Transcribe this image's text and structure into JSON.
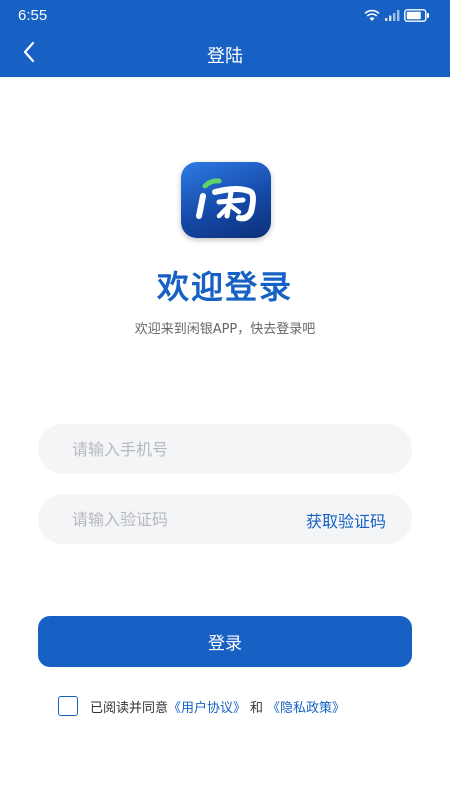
{
  "status_bar": {
    "time": "6:55",
    "icons": [
      "wifi-icon",
      "signal-icon",
      "battery-icon"
    ]
  },
  "nav": {
    "title": "登陆",
    "back_icon": "chevron-left-icon"
  },
  "logo": {
    "icon": "app-logo",
    "glyph_text": "闲"
  },
  "welcome": {
    "title": "欢迎登录",
    "subtitle": "欢迎来到闲银APP，快去登录吧"
  },
  "form": {
    "phone_placeholder": "请输入手机号",
    "phone_value": "",
    "code_placeholder": "请输入验证码",
    "code_value": "",
    "get_code_label": "获取验证码"
  },
  "login_button": "登录",
  "agreement": {
    "checked": false,
    "prefix": "已阅读并同意",
    "user_agreement": "《用户协议》",
    "connector": "和",
    "privacy_policy": "《隐私政策》"
  },
  "colors": {
    "primary": "#1761c4",
    "field_bg": "#f4f5f7",
    "placeholder": "#b5b8bf"
  }
}
